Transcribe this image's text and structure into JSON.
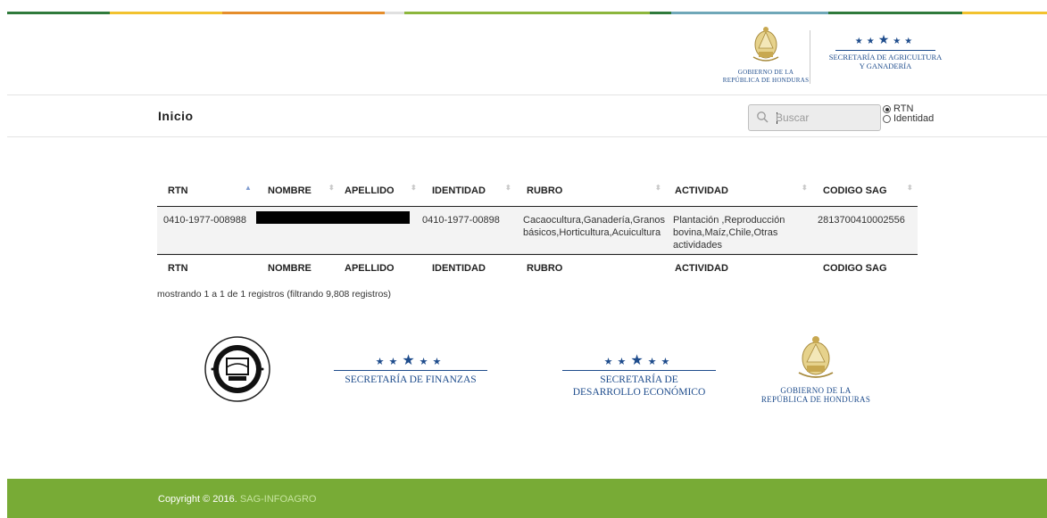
{
  "colors": {
    "stripe": [
      "#2f7a3b",
      "#f2c22e",
      "#e58d2b",
      "#e0e0e0",
      "#8cb63c",
      "#2f7a3b",
      "#6fa7b8",
      "#2f7a3b",
      "#f2c22e"
    ],
    "footer_bg": "#78ab36",
    "brand_blue": "#1e4c8c"
  },
  "header": {
    "gov_logo": {
      "line1": "Gobierno de la",
      "line2": "República de Honduras"
    },
    "sag_logo": {
      "line1": "Secretaría de Agricultura",
      "line2": "y Ganadería"
    }
  },
  "nav": {
    "title": "Inicio",
    "search_placeholder": "Buscar",
    "search_value": "",
    "radio_options": [
      {
        "label": "RTN",
        "checked": true
      },
      {
        "label": "Identidad",
        "checked": false
      }
    ]
  },
  "table": {
    "columns": [
      "RTN",
      "NOMBRE",
      "APELLIDO",
      "IDENTIDAD",
      "RUBRO",
      "ACTIVIDAD",
      "CODIGO SAG"
    ],
    "sorted_column": "RTN",
    "rows": [
      {
        "rtn": "0410-1977-008988",
        "nombre": "",
        "apellido": "",
        "identidad": "0410-1977-00898",
        "rubro_line1": "Cacaocultura,Ganadería,Granos",
        "rubro_line2": "básicos,Horticultura,Acuicultura",
        "actividad_line1": "Plantación ,Reproducción",
        "actividad_line2": "bovina,Maíz,Chile,Otras",
        "actividad_line3": "actividades",
        "codigo_sag": "2813700410002556"
      }
    ],
    "info": "mostrando 1 a 1 de 1 registros (filtrando 9,808 registros)"
  },
  "partners": {
    "finanzas": "Secretaría de Finanzas",
    "desarrollo_line1": "Secretaría de",
    "desarrollo_line2": "Desarrollo Económico",
    "gob_line1": "Gobierno de la",
    "gob_line2": "República de Honduras"
  },
  "footer": {
    "copyright": "Copyright © 2016.",
    "link": "SAG-INFOAGRO"
  }
}
